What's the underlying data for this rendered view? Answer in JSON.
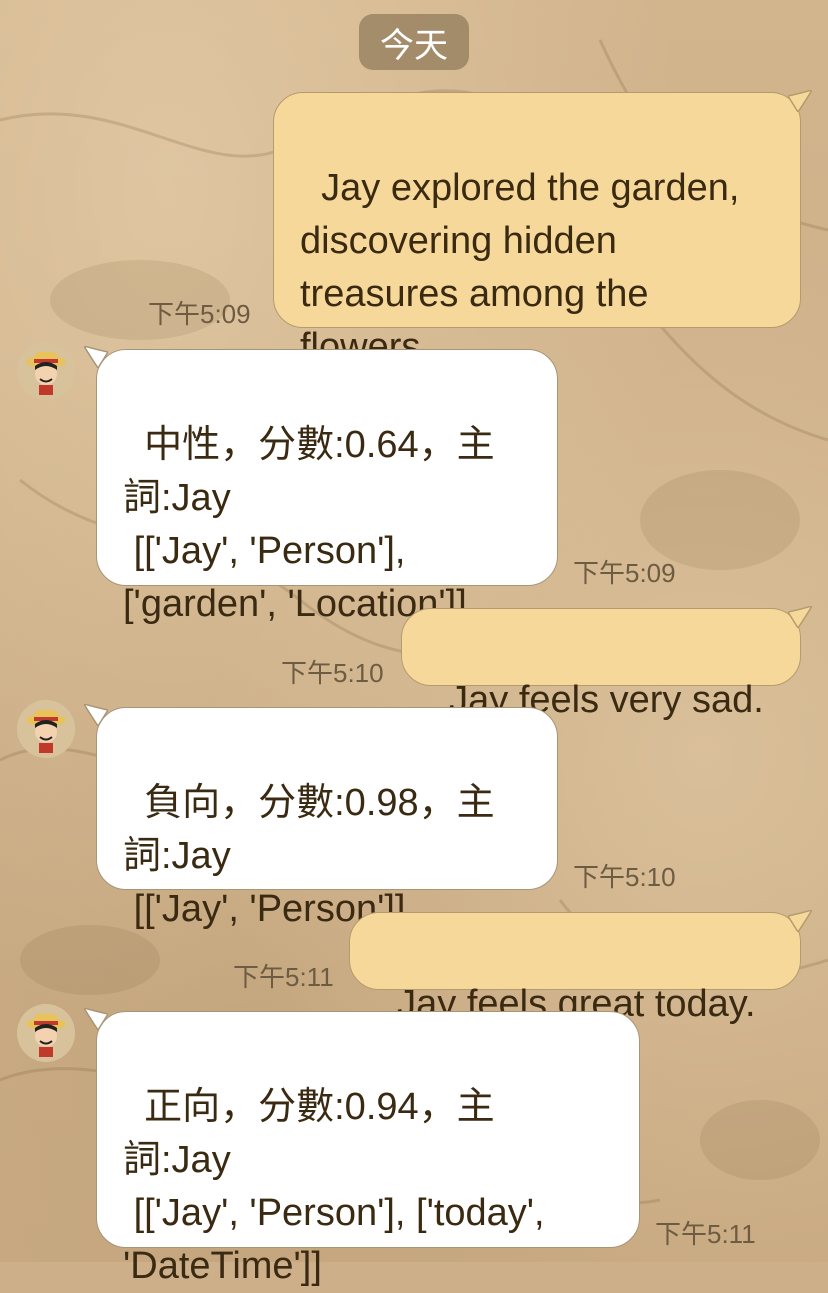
{
  "date_label": "今天",
  "messages": [
    {
      "id": "m1",
      "direction": "out",
      "text": "Jay explored the garden,\ndiscovering hidden\ntreasures among the\nflowers.",
      "time": "下午5:09"
    },
    {
      "id": "m2",
      "direction": "in",
      "avatar_icon": "straw-hat-avatar-icon",
      "text": "中性，分數:0.64，主\n詞:Jay\n [['Jay', 'Person'],\n['garden', 'Location']]",
      "time": "下午5:09"
    },
    {
      "id": "m3",
      "direction": "out",
      "text": "Jay feels very sad.",
      "time": "下午5:10"
    },
    {
      "id": "m4",
      "direction": "in",
      "avatar_icon": "straw-hat-avatar-icon",
      "text": "負向，分數:0.98，主\n詞:Jay\n [['Jay', 'Person']]",
      "time": "下午5:10"
    },
    {
      "id": "m5",
      "direction": "out",
      "text": "Jay feels great today.",
      "time": "下午5:11"
    },
    {
      "id": "m6",
      "direction": "in",
      "avatar_icon": "straw-hat-avatar-icon",
      "text": "正向，分數:0.94，主\n詞:Jay\n [['Jay', 'Person'], ['today',\n'DateTime']]",
      "time": "下午5:11"
    }
  ],
  "colors": {
    "outgoing_bubble": "#f6d99a",
    "incoming_bubble": "#ffffff",
    "text": "#3b2a12",
    "timestamp": "#6e5c42"
  }
}
